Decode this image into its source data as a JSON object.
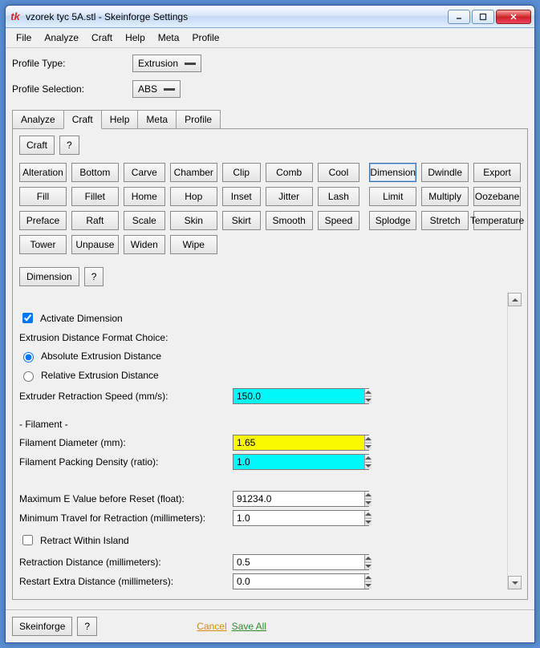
{
  "title": "vzorek tyc 5A.stl - Skeinforge Settings",
  "menu": [
    "File",
    "Analyze",
    "Craft",
    "Help",
    "Meta",
    "Profile"
  ],
  "profile_type": {
    "label": "Profile Type:",
    "value": "Extrusion"
  },
  "profile_selection": {
    "label": "Profile Selection:",
    "value": "ABS"
  },
  "top_tabs": [
    "Analyze",
    "Craft",
    "Help",
    "Meta",
    "Profile"
  ],
  "top_tab_active": "Craft",
  "craft_sub": {
    "btn": "Craft",
    "help": "?"
  },
  "plugins": [
    [
      "Alteration",
      "Bottom",
      "Carve",
      "Chamber",
      "Clip",
      "Comb",
      "Cool",
      "Dimension",
      "Dwindle",
      "Export"
    ],
    [
      "Fill",
      "Fillet",
      "Home",
      "Hop",
      "Inset",
      "Jitter",
      "Lash",
      "Limit",
      "Multiply",
      "Oozebane"
    ],
    [
      "Preface",
      "Raft",
      "Scale",
      "Skin",
      "Skirt",
      "Smooth",
      "Speed",
      "Splodge",
      "Stretch",
      "Temperature"
    ],
    [
      "Tower",
      "Unpause",
      "Widen",
      "Wipe"
    ]
  ],
  "plugin_active": "Dimension",
  "dimension_sub": {
    "btn": "Dimension",
    "help": "?"
  },
  "form": {
    "activate": {
      "label": "Activate Dimension",
      "checked": true
    },
    "format_choice_label": "Extrusion Distance Format Choice:",
    "abs_label": "Absolute Extrusion Distance",
    "rel_label": "Relative Extrusion Distance",
    "retraction_speed": {
      "label": "Extruder Retraction Speed (mm/s):",
      "value": "150.0"
    },
    "filament_header": "- Filament -",
    "diameter": {
      "label": "Filament Diameter (mm):",
      "value": "1.65"
    },
    "packing": {
      "label": "Filament Packing Density (ratio):",
      "value": "1.0"
    },
    "max_e": {
      "label": "Maximum E Value before Reset (float):",
      "value": "91234.0"
    },
    "min_travel": {
      "label": "Minimum Travel for Retraction (millimeters):",
      "value": "1.0"
    },
    "retract_island": {
      "label": "Retract Within Island",
      "checked": false
    },
    "retract_dist": {
      "label": "Retraction Distance (millimeters):",
      "value": "0.5"
    },
    "restart_extra": {
      "label": "Restart Extra Distance (millimeters):",
      "value": "0.0"
    }
  },
  "footer": {
    "skeinforge": "Skeinforge",
    "help": "?",
    "cancel": "Cancel",
    "save": "Save All"
  }
}
